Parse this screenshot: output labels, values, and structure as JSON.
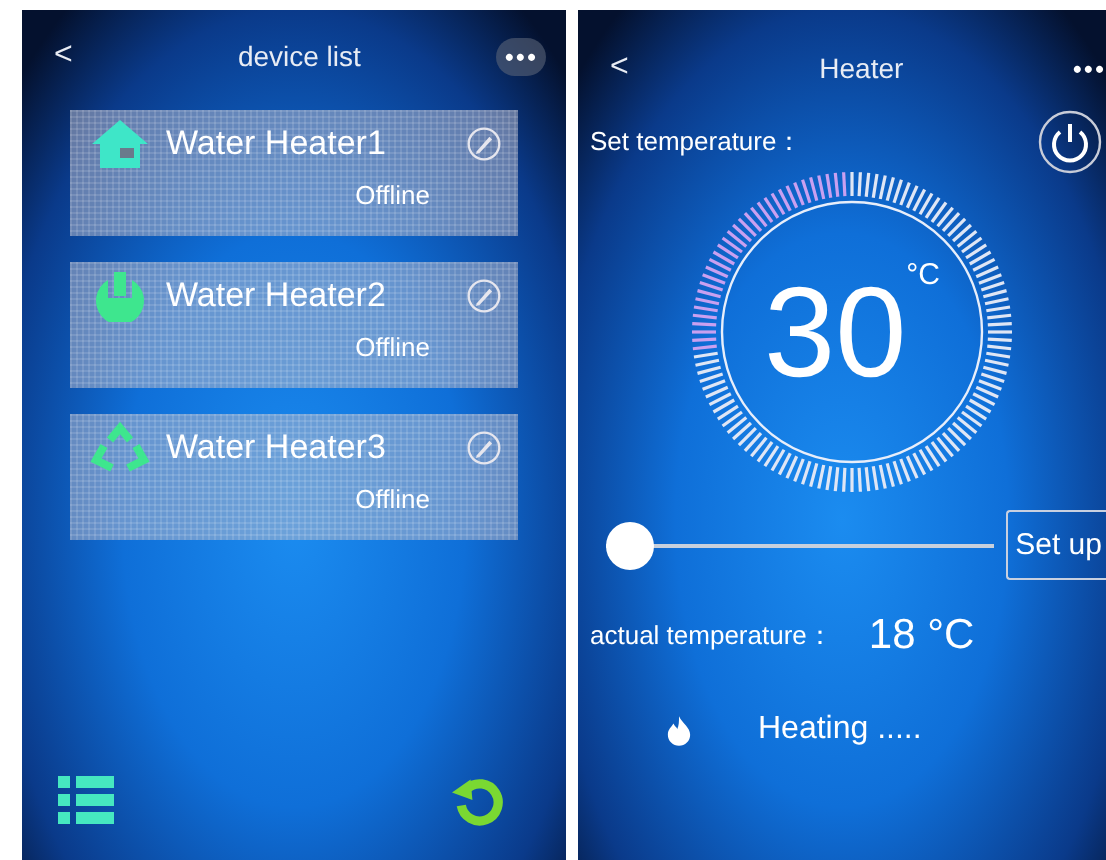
{
  "device_list": {
    "header": {
      "back": "<",
      "title": "device list",
      "more": "•••"
    },
    "devices": [
      {
        "name": "Water Heater1",
        "status": "Offline",
        "kind": "house"
      },
      {
        "name": "Water Heater2",
        "status": "Offline",
        "kind": "power"
      },
      {
        "name": "Water Heater3",
        "status": "Offline",
        "kind": "recycle"
      }
    ]
  },
  "heater": {
    "header": {
      "back": "<",
      "title": "Heater",
      "more": "•••"
    },
    "set_label": "Set temperature：",
    "set_value": "30",
    "set_unit": "°C",
    "slider": {
      "level": 0
    },
    "setup_button": "Set up",
    "actual_label": "actual temperature：",
    "actual_value": "18 °C",
    "status": "Heating ....."
  }
}
